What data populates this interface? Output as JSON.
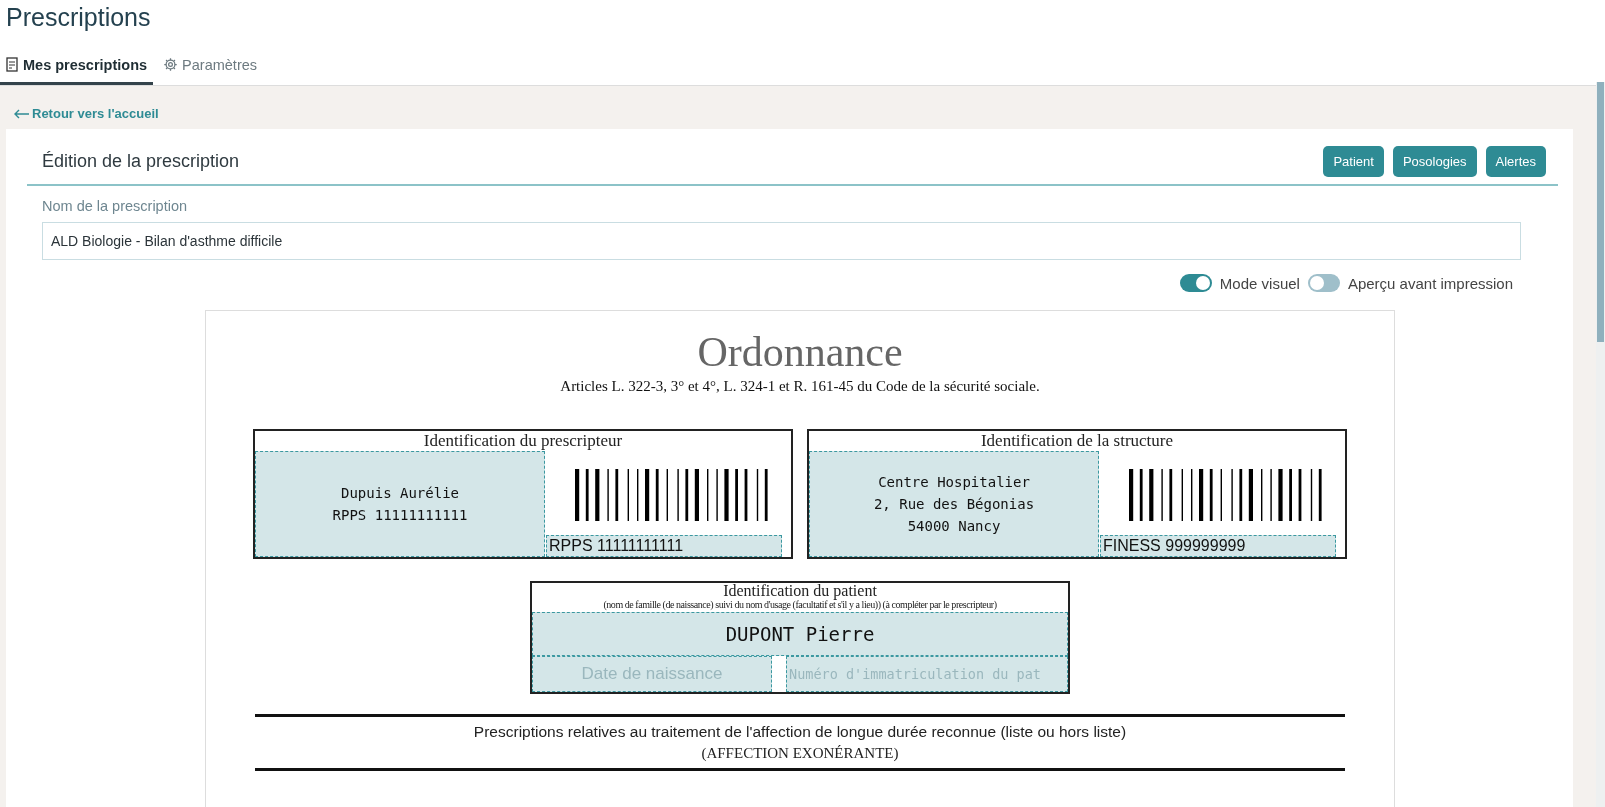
{
  "page_title": "Prescriptions",
  "tabs": [
    {
      "label": "Mes prescriptions",
      "selected": true,
      "kind": "document"
    },
    {
      "label": "Paramètres",
      "selected": false,
      "kind": "gear"
    }
  ],
  "back_link": "Retour vers l'accueil",
  "editor": {
    "title": "Édition de la prescription",
    "buttons": [
      "Patient",
      "Posologies",
      "Alertes"
    ],
    "name_label": "Nom de la prescription",
    "name_value": "ALD Biologie - Bilan d'asthme difficile",
    "toggles": [
      {
        "label": "Mode visuel",
        "on": true
      },
      {
        "label": "Aperçu avant impression",
        "on": false
      }
    ]
  },
  "document": {
    "title": "Ordonnance",
    "subtitle": "Articles L. 322-3, 3° et 4°, L. 324-1 et R. 161-45 du Code de la sécurité sociale.",
    "prescriber": {
      "heading": "Identification du prescripteur",
      "lines": [
        "Dupuis Aurélie",
        "RPPS 11111111111"
      ],
      "barcode_caption": "RPPS 11111111111"
    },
    "structure": {
      "heading": "Identification de la structure",
      "lines": [
        "Centre Hospitalier",
        "2, Rue des Bégonias",
        "54000 Nancy"
      ],
      "barcode_caption": "FINESS 999999999"
    },
    "patient": {
      "heading": "Identification du patient",
      "note": "(nom de famille (de naissance) suivi du nom d'usage (facultatif et s'il y a lieu)) (à compléter par le prescripteur)",
      "name": "DUPONT Pierre",
      "birth_placeholder": "Date de naissance",
      "number_placeholder": "Numéro d'immatriculation du pat"
    },
    "section": {
      "heading": "Prescriptions relatives au traitement de l'affection de longue durée reconnue (liste ou hors liste)",
      "subheading": "(AFFECTION EXONÉRANTE)"
    }
  }
}
